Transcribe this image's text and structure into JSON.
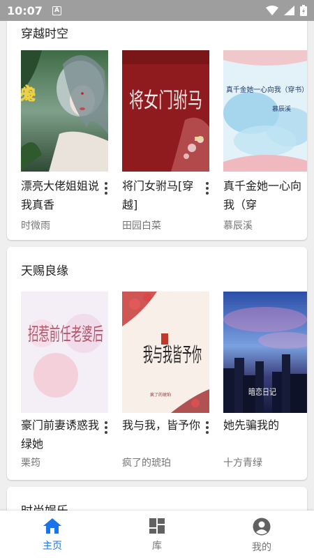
{
  "status_bar": {
    "time": "10:07",
    "notification_badge": "A"
  },
  "sections": [
    {
      "title": "穿越时空",
      "books": [
        {
          "title": "漂亮大佬姐姐说我真香",
          "author": "时微雨",
          "cover_text": "心尖宠"
        },
        {
          "title": "将门女驸马[穿越]",
          "author": "田园白菜",
          "cover_text": "将女门驸马"
        },
        {
          "title": "真千金她一心向我（穿",
          "author": "慕辰溪",
          "cover_text": "真千金她一心向我（穿书）"
        }
      ]
    },
    {
      "title": "天赐良缘",
      "books": [
        {
          "title": "豪门前妻诱惑我绿她",
          "author": "栗筠",
          "cover_text": "招惹前任老婆后"
        },
        {
          "title": "我与我，皆予你",
          "author": "疯了的琥珀",
          "cover_text": "我与我皆予你"
        },
        {
          "title": "她先骗我的",
          "author": "十方青绿",
          "cover_text": "暗恋日记"
        }
      ]
    },
    {
      "title": "时尚娱乐"
    }
  ],
  "bottom_nav": [
    {
      "label": "主页",
      "icon": "home-icon",
      "active": true
    },
    {
      "label": "库",
      "icon": "library-icon",
      "active": false
    },
    {
      "label": "我的",
      "icon": "account-icon",
      "active": false
    }
  ],
  "colors": {
    "accent": "#1a73e8",
    "status_bar": "#9e9e9e",
    "background": "#efefef"
  }
}
